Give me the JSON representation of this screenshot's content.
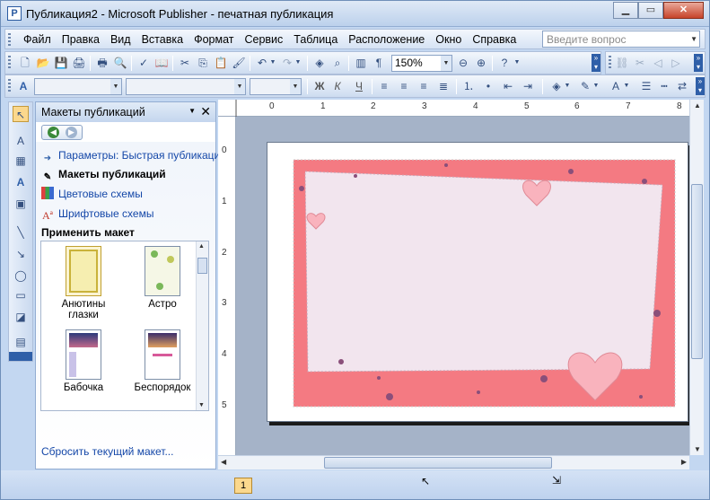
{
  "window": {
    "title": "Публикация2 - Microsoft Publisher - печатная публикация",
    "app_icon": "P"
  },
  "window_buttons": {
    "minimize": "▁",
    "maximize": "▭",
    "close": "✕"
  },
  "menu": [
    "Файл",
    "Правка",
    "Вид",
    "Вставка",
    "Формат",
    "Сервис",
    "Таблица",
    "Расположение",
    "Окно",
    "Справка"
  ],
  "ask_box": {
    "placeholder": "Введите вопрос"
  },
  "standard_toolbar": {
    "zoom": "150%"
  },
  "formatting_toolbar": {
    "style": "",
    "font": "",
    "size": "",
    "bold": "Ж",
    "italic": "К",
    "underline": "Ч"
  },
  "task_pane": {
    "title": "Макеты публикаций",
    "links": [
      {
        "label": "Параметры: Быстрая публикация",
        "icon": "arrow-icon",
        "active": false
      },
      {
        "label": "Макеты публикаций",
        "icon": "layout-icon",
        "active": true
      },
      {
        "label": "Цветовые схемы",
        "icon": "color-scheme-icon",
        "active": false
      },
      {
        "label": "Шрифтовые схемы",
        "icon": "font-scheme-icon",
        "active": false
      }
    ],
    "section_title": "Применить макет",
    "templates": [
      {
        "label": "Анютины глазки"
      },
      {
        "label": "Астро"
      },
      {
        "label": "Бабочка"
      },
      {
        "label": "Беспорядок"
      }
    ],
    "reset_link": "Сбросить текущий макет..."
  },
  "ruler": {
    "top_marks": [
      "0",
      "1",
      "2",
      "3",
      "4",
      "5",
      "6",
      "7",
      "8"
    ],
    "left_marks": [
      "0",
      "1",
      "2",
      "3",
      "4",
      "5"
    ]
  },
  "status": {
    "page_number": "1"
  },
  "colors": {
    "accent": "#2f5fa8",
    "card_border": "#f47a82",
    "card_inner": "#f2e5ee",
    "heart": "#f9b3bd"
  }
}
